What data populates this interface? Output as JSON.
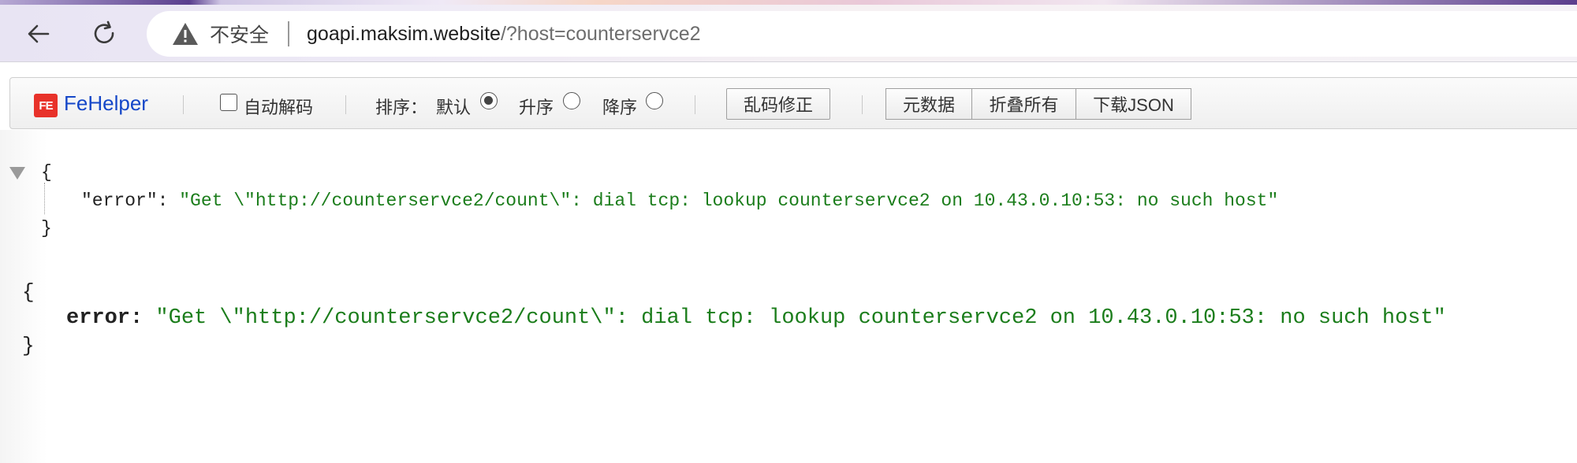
{
  "browser": {
    "security_label": "不安全",
    "url_host": "goapi.maksim.website",
    "url_path": "/?host=counterservce2"
  },
  "fehelper": {
    "logo_text": "FE",
    "brand": "FeHelper",
    "auto_decode_label": "自动解码",
    "sort_label": "排序：",
    "sort_options": [
      {
        "label": "默认",
        "selected": true
      },
      {
        "label": "升序",
        "selected": false
      },
      {
        "label": "降序",
        "selected": false
      }
    ],
    "fix_garbled_button": "乱码修正",
    "group_buttons": [
      "元数据",
      "折叠所有",
      "下载JSON"
    ]
  },
  "json_tree": {
    "open_brace": "{",
    "close_brace": "}",
    "key": "\"error\"",
    "colon": ": ",
    "value": "\"Get \\\"http://counterservce2/count\\\": dial tcp: lookup counterservce2 on 10.43.0.10:53: no such host\""
  },
  "raw_json": {
    "open_brace": "{",
    "close_brace": "}",
    "key": "error:",
    "value": "\"Get \\\"http://counterservce2/count\\\": dial tcp: lookup counterservce2 on 10.43.0.10:53: no such host\""
  },
  "colors": {
    "string_value": "#1b7d1b",
    "brand": "#1547c8",
    "logo_bg": "#e8322a"
  }
}
